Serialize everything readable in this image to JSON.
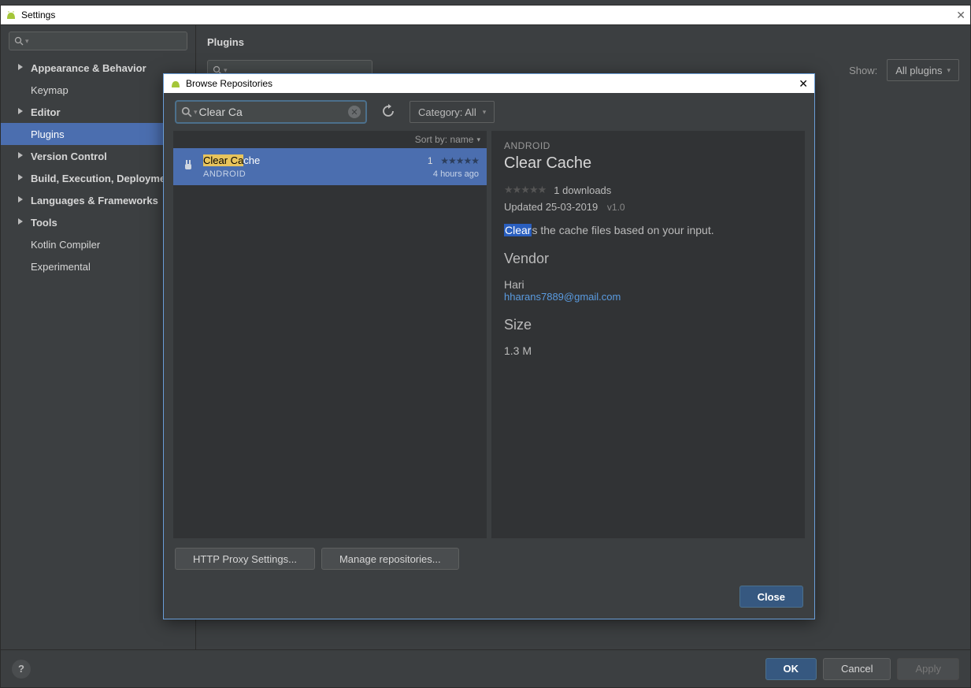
{
  "settings": {
    "title": "Settings",
    "sidebar": {
      "items": [
        {
          "label": "Appearance & Behavior",
          "expandable": true,
          "child": false
        },
        {
          "label": "Keymap",
          "expandable": false,
          "child": true
        },
        {
          "label": "Editor",
          "expandable": true,
          "child": false
        },
        {
          "label": "Plugins",
          "expandable": false,
          "child": true,
          "selected": true
        },
        {
          "label": "Version Control",
          "expandable": true,
          "child": false
        },
        {
          "label": "Build, Execution, Deployment",
          "expandable": true,
          "child": false
        },
        {
          "label": "Languages & Frameworks",
          "expandable": true,
          "child": false
        },
        {
          "label": "Tools",
          "expandable": true,
          "child": false
        },
        {
          "label": "Kotlin Compiler",
          "expandable": false,
          "child": true
        },
        {
          "label": "Experimental",
          "expandable": false,
          "child": true
        }
      ]
    },
    "panelTitle": "Plugins",
    "showLabel": "Show:",
    "showDropdown": "All plugins",
    "footer": {
      "ok": "OK",
      "cancel": "Cancel",
      "apply": "Apply"
    }
  },
  "modal": {
    "title": "Browse Repositories",
    "searchValue": "Clear Ca",
    "categoryLabel": "Category: All",
    "sortLabel": "Sort by: name",
    "result": {
      "highlight": "Clear Ca",
      "titleRest": "che",
      "category": "ANDROID",
      "count": "1",
      "time": "4 hours ago"
    },
    "detail": {
      "category": "ANDROID",
      "title": "Clear Cache",
      "downloads": "1 downloads",
      "updated": "Updated 25-03-2019",
      "version": "v1.0",
      "descHighlight": "Clear",
      "descRest": "s the cache files based on your input.",
      "vendorHeading": "Vendor",
      "vendorName": "Hari",
      "vendorEmail": "hharans7889@gmail.com",
      "sizeHeading": "Size",
      "size": "1.3 M"
    },
    "httpProxy": "HTTP Proxy Settings...",
    "manageRepos": "Manage repositories...",
    "close": "Close"
  }
}
